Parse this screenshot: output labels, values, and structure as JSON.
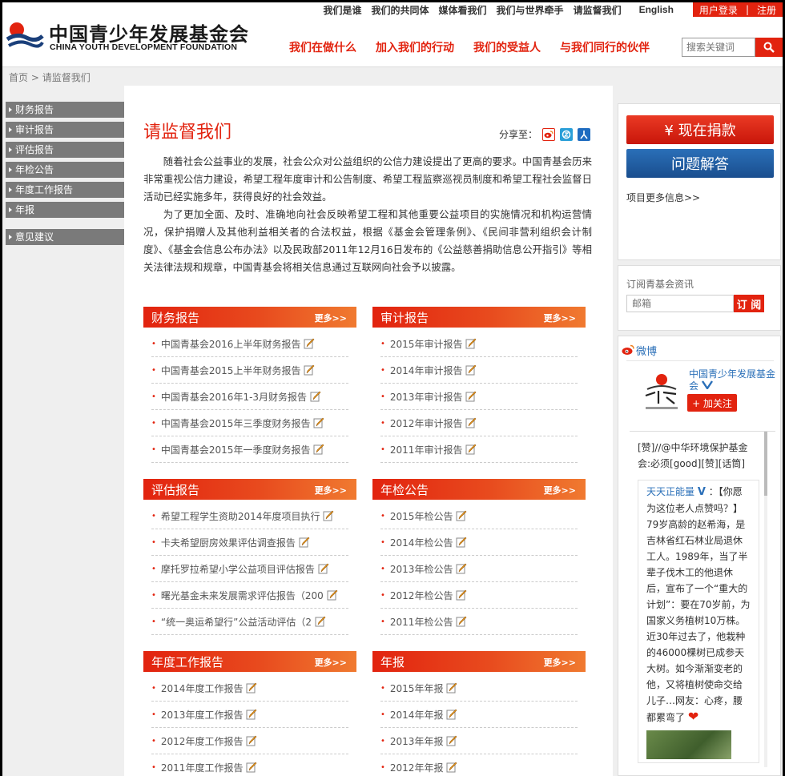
{
  "header": {
    "logo_cn": "中国青少年发展基金会",
    "logo_en": "CHINA YOUTH DEVELOPMENT FOUNDATION",
    "top_nav": [
      "我们是谁",
      "我们的共同体",
      "媒体看我们",
      "我们与世界牵手",
      "请监督我们"
    ],
    "english": "English",
    "login": "用户登录",
    "separator": "|",
    "register": "注册",
    "main_nav": [
      "我们在做什么",
      "加入我们的行动",
      "我们的受益人",
      "与我们同行的伙伴"
    ],
    "search_placeholder": "搜索关键词"
  },
  "breadcrumb": {
    "home": "首页",
    "sep": ">",
    "current": "请监督我们"
  },
  "left_menu": {
    "items": [
      "财务报告",
      "审计报告",
      "评估报告",
      "年检公告",
      "年度工作报告",
      "年报"
    ],
    "extra": "意见建议"
  },
  "main": {
    "title": "请监督我们",
    "share_label": "分享至：",
    "intro_p1": "随着社会公益事业的发展，社会公众对公益组织的公信力建设提出了更高的要求。中国青基会历来非常重视公信力建设，希望工程年度审计和公告制度、希望工程监察巡视员制度和希望工程社会监督日活动已经实施多年，获得良好的社会效益。",
    "intro_p2": "为了更加全面、及时、准确地向社会反映希望工程和其他重要公益项目的实施情况和机构运营情况，保护捐赠人及其他利益相关者的合法权益，根据《基金会管理条例》、《民间非营利组织会计制度》、《基金会信息公布办法》以及民政部2011年12月16日发布的《公益慈善捐助信息公开指引》等相关法律法规和规章，中国青基会将相关信息通过互联网向社会予以披露。",
    "more": "更多>>",
    "sections": [
      {
        "title": "财务报告",
        "items": [
          "中国青基会2016上半年财务报告",
          "中国青基会2015上半年财务报告",
          "中国青基会2016年1-3月财务报告",
          "中国青基会2015年三季度财务报告",
          "中国青基会2015年一季度财务报告"
        ]
      },
      {
        "title": "审计报告",
        "items": [
          "2015年审计报告",
          "2014年审计报告",
          "2013年审计报告",
          "2012年审计报告",
          "2011年审计报告"
        ]
      },
      {
        "title": "评估报告",
        "items": [
          "希望工程学生资助2014年度项目执行",
          "卡夫希望厨房效果评估调查报告",
          "摩托罗拉希望小学公益项目评估报告",
          "曙光基金未来发展需求评估报告（200",
          "“统一奥运希望行”公益活动评估（2"
        ]
      },
      {
        "title": "年检公告",
        "items": [
          "2015年检公告",
          "2014年检公告",
          "2013年检公告",
          "2012年检公告",
          "2011年检公告"
        ]
      },
      {
        "title": "年度工作报告",
        "items": [
          "2014年度工作报告",
          "2013年度工作报告",
          "2012年度工作报告",
          "2011年度工作报告"
        ]
      },
      {
        "title": "年报",
        "items": [
          "2015年年报",
          "2014年年报",
          "2013年年报",
          "2012年年报"
        ]
      }
    ]
  },
  "right": {
    "donate": "¥ 现在捐款",
    "faq": "问题解答",
    "more_info": "项目更多信息>>",
    "subscribe_title": "订阅青基会资讯",
    "subscribe_placeholder": "邮箱",
    "subscribe_btn": "订 阅",
    "weibo_title": "微博",
    "weibo_name": "中国青少年发展基金会",
    "follow": "+ 加关注",
    "feed_top": "[赞]//@中华环境保护基金会:必须[good][赞][话筒]",
    "post_user": "天天正能量",
    "post_text": "：【你愿为这位老人点赞吗？】79岁高龄的赵希海，是吉林省红石林业局退休工人。1989年，当了半辈子伐木工的他退休后，宣布了一个“重大的计划”：要在70岁前，为国家义务植树10万株。近30年过去了，他栽种的46000棵树已成参天大树。如今渐渐变老的他，又将植树使命交给儿子…网友：心疼，腰都累弯了"
  },
  "colors": {
    "brand_red": "#e2230f",
    "faq_blue": "#2a6fb8",
    "menu_gray": "#7a7a7a"
  }
}
